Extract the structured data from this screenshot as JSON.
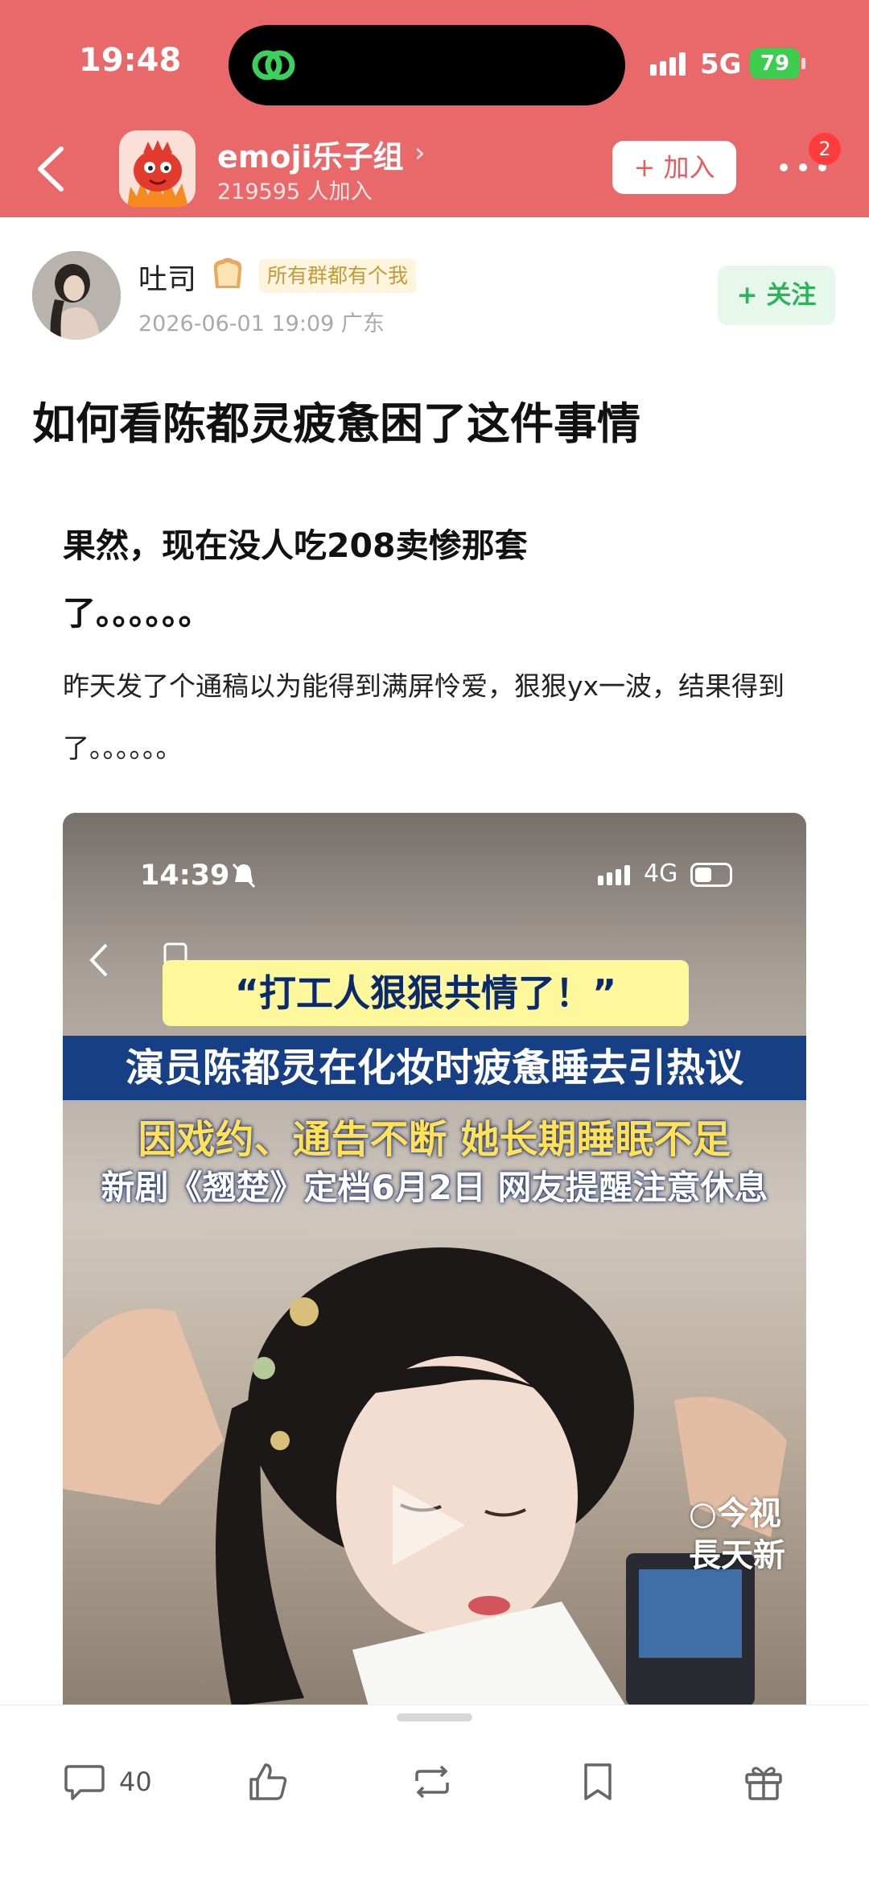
{
  "status_bar": {
    "time": "19:48",
    "network": "5G",
    "battery": "79"
  },
  "group": {
    "name": "emoji乐子组",
    "members": "219595 人加入",
    "join_label": "+ 加入",
    "notification_count": "2"
  },
  "author": {
    "name": "吐司",
    "tag": "所有群都有个我",
    "meta": "2026-06-01 19:09  广东",
    "follow_label": "+ 关注"
  },
  "post": {
    "title": "如何看陈都灵疲惫困了这件事情",
    "subtitle": "果然，现在没人吃208卖惨那套了。。。。。。",
    "body": "昨天发了个通稿以为能得到满屏怜爱，狠狠yx一波，结果得到了。。。。。。"
  },
  "video": {
    "time": "14:39",
    "network": "4G",
    "quote": "“打工人狠狠共情了！”",
    "headline": "演员陈都灵在化妆时疲惫睡去引热议",
    "line2": "因戏约、通告不断 她长期睡眠不足",
    "line3": "新剧《翘楚》定档6月2日 网友提醒注意休息",
    "watermark_line1": "今视",
    "watermark_line2": "長天新"
  },
  "bottom_bar": {
    "comment_count": "40",
    "icons": [
      "comment-icon",
      "like-icon",
      "repost-icon",
      "bookmark-icon",
      "gift-icon"
    ]
  },
  "colors": {
    "header_bg": "#e9696b",
    "follow_green": "#2fb35a",
    "headline_blue": "#173f86",
    "quote_yellow": "#fff79c"
  }
}
